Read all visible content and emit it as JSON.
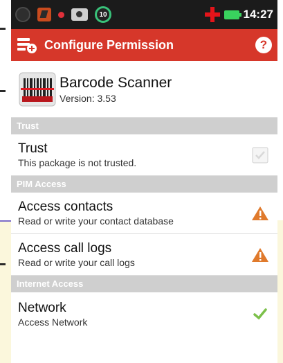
{
  "statusbar": {
    "badge_number": "10",
    "time": "14:27",
    "icons": [
      "usb-icon",
      "app-notification-icon",
      "red-dot-icon",
      "camera-icon",
      "counter-badge-icon",
      "red-cross-icon",
      "battery-icon"
    ]
  },
  "actionbar": {
    "title": "Configure Permission",
    "help_label": "?",
    "accent_color": "#d6372a"
  },
  "app": {
    "name": "Barcode Scanner",
    "version": "Version: 3.53",
    "icon": "barcode-icon"
  },
  "sections": {
    "trust": "Trust",
    "pim": "PIM Access",
    "internet": "Internet Access"
  },
  "rows": {
    "trust": {
      "title": "Trust",
      "subtitle": "This package is not trusted.",
      "indicator": "checkbox-unchecked"
    },
    "contacts": {
      "title": "Access contacts",
      "subtitle": "Read or write your contact database",
      "indicator": "warning-icon"
    },
    "calllogs": {
      "title": "Access call logs",
      "subtitle": "Read or write your call logs",
      "indicator": "warning-icon"
    },
    "network": {
      "title": "Network",
      "subtitle": "Access Network",
      "indicator": "check-icon"
    }
  },
  "colors": {
    "warning": "#e07a2c",
    "check": "#7cc04a",
    "section_bg": "#cfcfcf"
  }
}
